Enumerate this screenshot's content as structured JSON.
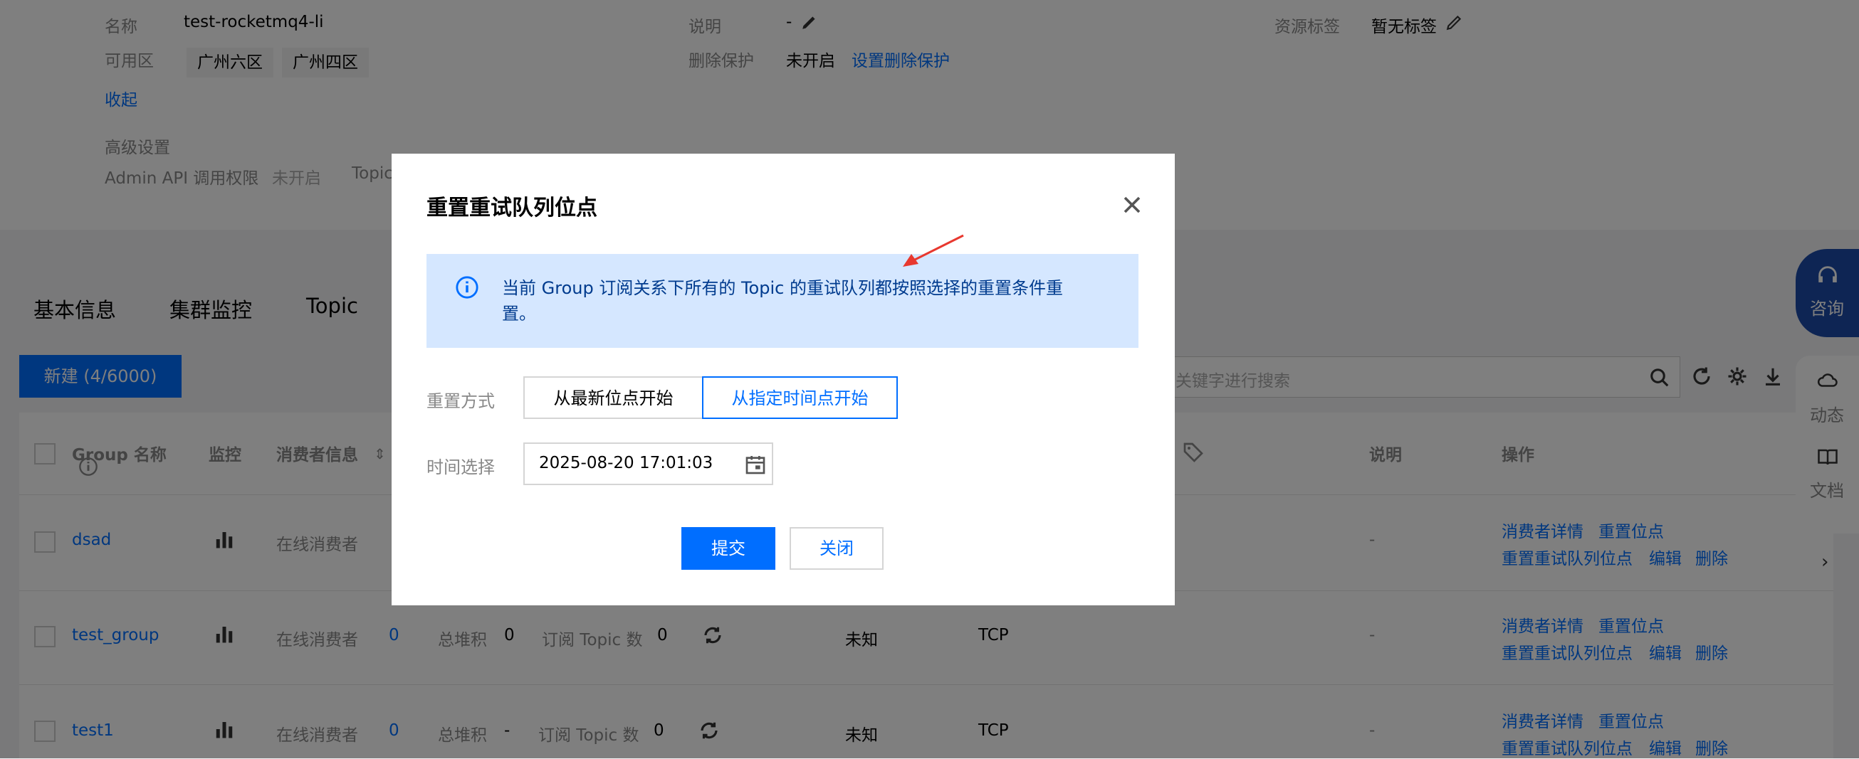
{
  "info": {
    "name_label": "名称",
    "name_value": "test-rocketmq4-li",
    "desc_label": "说明",
    "desc_value": "-",
    "tag_label": "资源标签",
    "tag_value": "暂无标签",
    "zone_label": "可用区",
    "zones": [
      "广州六区",
      "广州四区"
    ],
    "delete_protect_label": "删除保护",
    "delete_protect_value": "未开启",
    "delete_protect_link": "设置删除保护",
    "collapse_link": "收起",
    "advanced_label": "高级设置",
    "admin_api_label": "Admin API 调用权限",
    "admin_api_value": "未开启",
    "topic_partial": "Topic"
  },
  "tabs": [
    "基本信息",
    "集群监控",
    "Topic"
  ],
  "toolbar": {
    "new_button": "新建 (4/6000)",
    "search_placeholder": "关键字进行搜索"
  },
  "table": {
    "headers": {
      "group": "Group 名称",
      "monitor": "监控",
      "consumer": "消费者信息",
      "desc": "说明",
      "ops": "操作"
    },
    "rows": [
      {
        "name": "dsad",
        "online_label": "在线消费者",
        "online": "",
        "backlog_label": "",
        "backlog": "",
        "sub_label": "",
        "sub": "",
        "state": "",
        "protocol": "",
        "desc": "-",
        "op1": "消费者详情",
        "op2": "重置位点",
        "op3": "重置重试队列位点",
        "op4": "编辑",
        "op5": "删除"
      },
      {
        "name": "test_group",
        "online_label": "在线消费者",
        "online": "0",
        "backlog_label": "总堆积",
        "backlog": "0",
        "sub_label": "订阅 Topic 数",
        "sub": "0",
        "state": "未知",
        "protocol": "TCP",
        "desc": "-",
        "op1": "消费者详情",
        "op2": "重置位点",
        "op3": "重置重试队列位点",
        "op4": "编辑",
        "op5": "删除"
      },
      {
        "name": "test1",
        "online_label": "在线消费者",
        "online": "0",
        "backlog_label": "总堆积",
        "backlog": "-",
        "sub_label": "订阅 Topic 数",
        "sub": "0",
        "state": "未知",
        "protocol": "TCP",
        "desc": "-",
        "op1": "消费者详情",
        "op2": "重置位点",
        "op3": "重置重试队列位点",
        "op4": "编辑",
        "op5": "删除"
      }
    ]
  },
  "side": {
    "consult": "咨询",
    "dynamic": "动态",
    "docs": "文档"
  },
  "modal": {
    "title": "重置重试队列位点",
    "notice": "当前 Group 订阅关系下所有的 Topic 的重试队列都按照选择的重置条件重置。",
    "reset_mode_label": "重置方式",
    "option_latest": "从最新位点开始",
    "option_time": "从指定时间点开始",
    "time_label": "时间选择",
    "time_value": "2025-08-20 17:01:03",
    "submit": "提交",
    "close": "关闭"
  },
  "colors": {
    "primary": "#006eff",
    "notice_bg": "#d5e7ff",
    "overlay": "rgba(0,0,0,0.5)",
    "annotation_arrow": "#e8382f"
  }
}
